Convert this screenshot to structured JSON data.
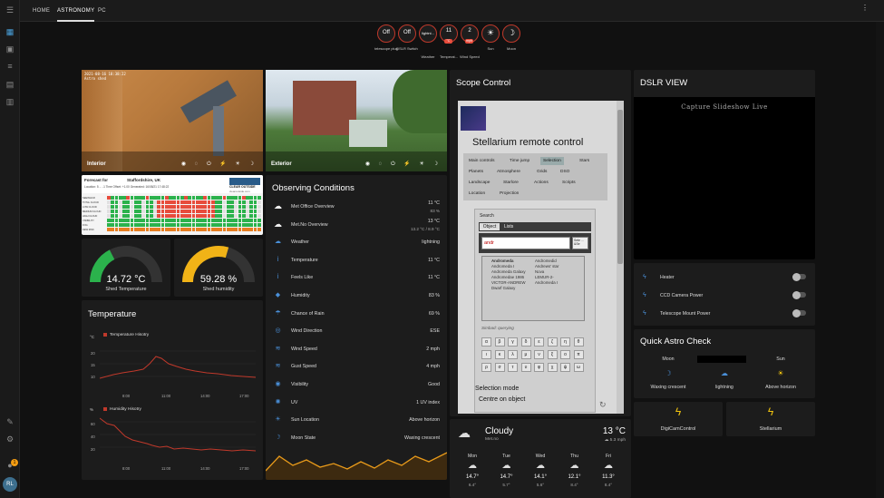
{
  "nav": {
    "tabs": [
      "HOME",
      "ASTRONOMY",
      "PC"
    ],
    "active_tab": "ASTRONOMY",
    "user_initials": "RL",
    "notification_count": "1"
  },
  "badges": [
    {
      "value": "Off",
      "label": "telescope plug"
    },
    {
      "value": "Off",
      "label": "DSLR Switch"
    },
    {
      "value": "lightni...",
      "label": "Weather"
    },
    {
      "value": "11",
      "unit": "°C",
      "label": "Temperat..."
    },
    {
      "value": "2",
      "unit": "mph",
      "label": "Wind Speed"
    },
    {
      "value": "",
      "label": "Sun"
    },
    {
      "value": "",
      "label": "Moon"
    }
  ],
  "cameras": {
    "interior": {
      "label": "Interior",
      "stamp": "2021-08-16 18:38:22\nAstro shed"
    },
    "exterior": {
      "label": "Exterior"
    }
  },
  "forecast": {
    "title": "Forecast for",
    "place": "Staffordshire, UK",
    "meta": "Location: 5 ... -1  Time Offset: +1.00  Generated: 16/08/21 17:48:22",
    "brand": "CLEAR OUTSIDE",
    "brand_sub": "clearoutside.com",
    "rows": [
      "SEEING/UK",
      "TOTAL CLOUD",
      "LOW CLOUD",
      "MEDIUM CLOUD",
      "HIGH CLOUD",
      "VISIBILITY",
      "FOG",
      "DEW RISK"
    ]
  },
  "gauges": [
    {
      "value": "14.72 °C",
      "label": "Shed Temperature",
      "fraction": 0.35,
      "color": "#2bb24c"
    },
    {
      "value": "59.28 %",
      "label": "Shed humidity",
      "fraction": 0.59,
      "color": "#f1b317"
    }
  ],
  "temperature": {
    "title": "Temperature",
    "chart1": {
      "unit": "°C",
      "legend": "Temperature Hisotry",
      "yticks": [
        "20",
        "15",
        "10"
      ],
      "xticks": [
        "8:00",
        "11:00",
        "14:00",
        "17:00"
      ]
    },
    "chart2": {
      "unit": "%",
      "legend": "Humidity Hisotry",
      "yticks": [
        "60",
        "40",
        "20"
      ],
      "xticks": [
        "8:00",
        "11:00",
        "14:00",
        "17:00"
      ]
    }
  },
  "observing": {
    "title": "Observing Conditions",
    "rows": [
      {
        "icon": "cloud-icon",
        "label": "Met Office Overview",
        "value": "11 °C",
        "value2": "83 %"
      },
      {
        "icon": "cloud-icon",
        "label": "Met.No Overview",
        "value": "13 °C",
        "value2": "13.2 °C / 8.9 °C"
      },
      {
        "icon": "weather-icon",
        "label": "Weather",
        "value": "lightning"
      },
      {
        "icon": "thermometer-icon",
        "label": "Temperature",
        "value": "11 °C"
      },
      {
        "icon": "thermometer-icon",
        "label": "Feels Like",
        "value": "11 °C"
      },
      {
        "icon": "humidity-icon",
        "label": "Humidity",
        "value": "83 %"
      },
      {
        "icon": "rain-icon",
        "label": "Chance of Rain",
        "value": "69 %"
      },
      {
        "icon": "compass-icon",
        "label": "Wind Direction",
        "value": "ESE"
      },
      {
        "icon": "wind-icon",
        "label": "Wind Speed",
        "value": "2 mph"
      },
      {
        "icon": "wind-icon",
        "label": "Gust Speed",
        "value": "4 mph"
      },
      {
        "icon": "eye-icon",
        "label": "Visibility",
        "value": "Good"
      },
      {
        "icon": "uv-icon",
        "label": "UV",
        "value": "1 UV index"
      },
      {
        "icon": "sun-icon",
        "label": "Sun Location",
        "value": "Above horizon"
      },
      {
        "icon": "moon-icon",
        "label": "Moon State",
        "value": "Waxing crescent"
      }
    ]
  },
  "scope": {
    "title": "Scope Control",
    "app_title": "Stellarium remote control",
    "tabs_row1": [
      "Main controls",
      "Time jump",
      "Selection",
      "Stars"
    ],
    "tabs_row2": [
      "Planets",
      "Atmosphere",
      "Grids",
      "DSO"
    ],
    "tabs_row3": [
      "Landscape",
      "Starlore",
      "Actions",
      "Scripts"
    ],
    "tabs_row4": [
      "Location",
      "Projection"
    ],
    "search_title": "Search",
    "subtabs": [
      "Object",
      "Lists"
    ],
    "input_value": "andr",
    "side_btn": "Sele ... &Se",
    "results": [
      "Andromeda",
      "Andromedid",
      "Andromeda I",
      "Andrews' star",
      "Andromeda Galaxy",
      "Nova",
      "Andromedae 1986",
      "LEMUR-2-",
      "VICTOR-ANDREW",
      "Andromeda I",
      "Dwarf Galaxy",
      ""
    ],
    "status": "Simbad: querying",
    "keys": [
      "α",
      "β",
      "γ",
      "δ",
      "ε",
      "ζ",
      "η",
      "θ",
      "ι",
      "κ",
      "λ",
      "μ",
      "ν",
      "ξ",
      "ο",
      "π",
      "ρ",
      "σ",
      "τ",
      "υ",
      "φ",
      "χ",
      "ψ",
      "ω"
    ],
    "selection_mode": "Selection mode",
    "selection_value": "Centre on object"
  },
  "dslr": {
    "title": "DSLR VIEW",
    "caption": "Capture Slideshow Live",
    "toggles": [
      {
        "label": "Heater"
      },
      {
        "label": "CCD Camera Power"
      },
      {
        "label": "Telescope Mount Power"
      }
    ]
  },
  "quick": {
    "title": "Quick Astro Check",
    "cols": [
      {
        "head": "Moon",
        "value": "Waxing crescent"
      },
      {
        "head": "",
        "value": "lightning"
      },
      {
        "head": "Sun",
        "value": "Above horizon"
      }
    ],
    "buttons": [
      "DigiCamControl",
      "Stellarium"
    ]
  },
  "weather": {
    "condition": "Cloudy",
    "source": "Met.no",
    "temp": "13 °C",
    "wind": "5.3 mph",
    "days": [
      {
        "day": "Mon",
        "high": "14.7°",
        "low": "6.4°"
      },
      {
        "day": "Tue",
        "high": "14.7°",
        "low": "5.7°"
      },
      {
        "day": "Wed",
        "high": "14.1°",
        "low": "5.6°"
      },
      {
        "day": "Thu",
        "high": "12.1°",
        "low": "8.4°"
      },
      {
        "day": "Fri",
        "high": "11.3°",
        "low": "8.4°"
      }
    ]
  }
}
